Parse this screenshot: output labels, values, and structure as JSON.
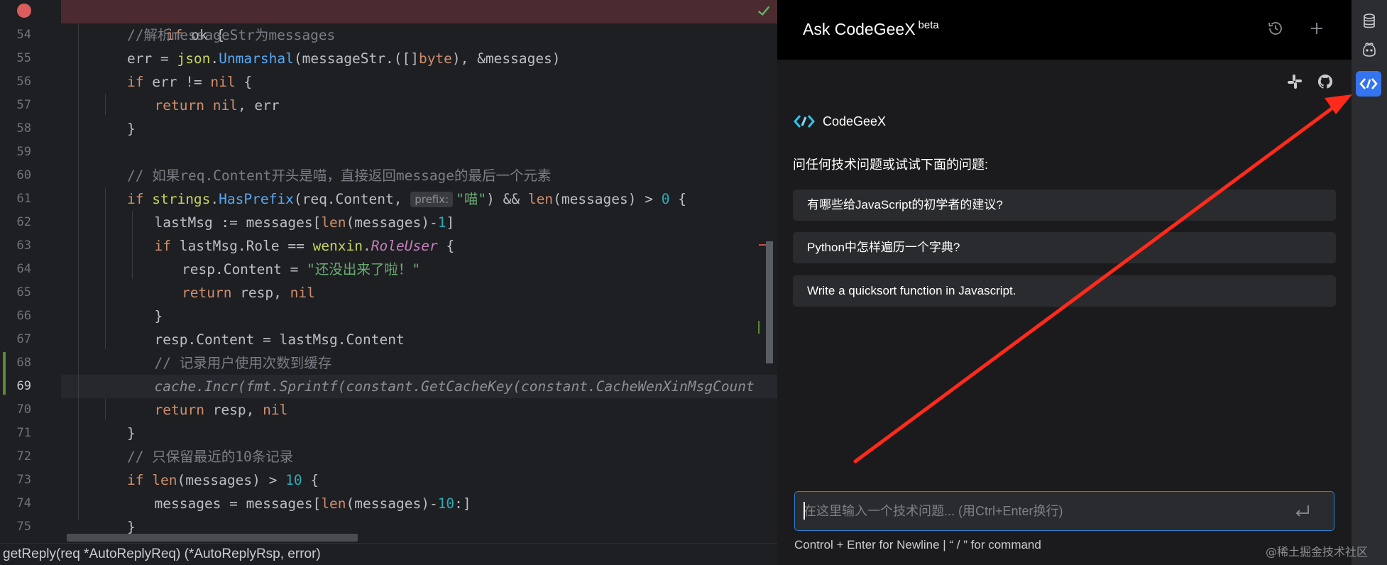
{
  "editor": {
    "breakpoint_line_text": "if ok {",
    "lines": [
      {
        "num": "54",
        "tokens": [
          [
            "cm",
            "//解析messageStr为messages"
          ]
        ]
      },
      {
        "num": "55",
        "tokens": [
          [
            "plain",
            "err = "
          ],
          [
            "pkg",
            "json"
          ],
          [
            "plain",
            "."
          ],
          [
            "fn",
            "Unmarshal"
          ],
          [
            "plain",
            "(messageStr.([]"
          ],
          [
            "kw",
            "byte"
          ],
          [
            "plain",
            "), &messages)"
          ]
        ]
      },
      {
        "num": "56",
        "tokens": [
          [
            "kw",
            "if"
          ],
          [
            "plain",
            " err != "
          ],
          [
            "kw",
            "nil"
          ],
          [
            "plain",
            " {"
          ]
        ]
      },
      {
        "num": "57",
        "tokens": [
          [
            "kw",
            "return"
          ],
          [
            "plain",
            " "
          ],
          [
            "kw",
            "nil"
          ],
          [
            "plain",
            ", err"
          ]
        ]
      },
      {
        "num": "58",
        "tokens": [
          [
            "plain",
            "}"
          ]
        ]
      },
      {
        "num": "59",
        "tokens": []
      },
      {
        "num": "60",
        "tokens": [
          [
            "cm",
            "// 如果req.Content开头是喵，直接返回message的最后一个元素"
          ]
        ]
      },
      {
        "num": "61",
        "tokens": [
          [
            "kw",
            "if"
          ],
          [
            "plain",
            " "
          ],
          [
            "pkg",
            "strings"
          ],
          [
            "plain",
            "."
          ],
          [
            "fn",
            "HasPrefix"
          ],
          [
            "plain",
            "(req.Content, "
          ],
          [
            "hint",
            "prefix:"
          ],
          [
            "str",
            "\"喵\""
          ],
          [
            "plain",
            ") && "
          ],
          [
            "kw",
            "len"
          ],
          [
            "plain",
            "(messages) > "
          ],
          [
            "num",
            "0"
          ],
          [
            "plain",
            " {"
          ]
        ]
      },
      {
        "num": "62",
        "tokens": [
          [
            "plain",
            "lastMsg := messages["
          ],
          [
            "kw",
            "len"
          ],
          [
            "plain",
            "(messages)-"
          ],
          [
            "num",
            "1"
          ],
          [
            "plain",
            "]"
          ]
        ]
      },
      {
        "num": "63",
        "tokens": [
          [
            "kw",
            "if"
          ],
          [
            "plain",
            " lastMsg.Role == "
          ],
          [
            "pkg",
            "wenxin"
          ],
          [
            "plain",
            "."
          ],
          [
            "const",
            "RoleUser"
          ],
          [
            "plain",
            " {"
          ]
        ]
      },
      {
        "num": "64",
        "tokens": [
          [
            "plain",
            "resp.Content = "
          ],
          [
            "str",
            "\"还没出来了啦！\""
          ]
        ]
      },
      {
        "num": "65",
        "tokens": [
          [
            "kw",
            "return"
          ],
          [
            "plain",
            " resp, "
          ],
          [
            "kw",
            "nil"
          ]
        ]
      },
      {
        "num": "66",
        "tokens": [
          [
            "plain",
            "}"
          ]
        ]
      },
      {
        "num": "67",
        "tokens": [
          [
            "plain",
            "resp.Content = lastMsg.Content"
          ]
        ]
      },
      {
        "num": "68",
        "tokens": [
          [
            "cm",
            "// 记录用户使用次数到缓存"
          ]
        ]
      },
      {
        "num": "69",
        "tokens": [
          [
            "ital",
            "cache.Incr(fmt.Sprintf(constant.GetCacheKey(constant.CacheWenXinMsgCount"
          ]
        ]
      },
      {
        "num": "70",
        "tokens": [
          [
            "kw",
            "return"
          ],
          [
            "plain",
            " resp, "
          ],
          [
            "kw",
            "nil"
          ]
        ]
      },
      {
        "num": "71",
        "tokens": [
          [
            "plain",
            "}"
          ]
        ]
      },
      {
        "num": "72",
        "tokens": [
          [
            "cm",
            "// 只保留最近的10条记录"
          ]
        ]
      },
      {
        "num": "73",
        "tokens": [
          [
            "kw",
            "if"
          ],
          [
            "plain",
            " "
          ],
          [
            "kw",
            "len"
          ],
          [
            "plain",
            "(messages) > "
          ],
          [
            "num",
            "10"
          ],
          [
            "plain",
            " {"
          ]
        ]
      },
      {
        "num": "74",
        "tokens": [
          [
            "plain",
            "messages = messages["
          ],
          [
            "kw",
            "len"
          ],
          [
            "plain",
            "(messages)-"
          ],
          [
            "num",
            "10"
          ],
          [
            "plain",
            ":]"
          ]
        ]
      },
      {
        "num": "75",
        "tokens": [
          [
            "plain",
            "}"
          ]
        ]
      }
    ],
    "status_text": "getReply(req *AutoReplyReq) (*AutoReplyRsp, error)"
  },
  "panel": {
    "title": "Ask CodeGeeX",
    "title_badge": "beta",
    "brand_name": "CodeGeeX",
    "prompt": "问任何技术问题或试试下面的问题:",
    "suggestions": [
      "有哪些给JavaScript的初学者的建议?",
      "Python中怎样遍历一个字典?",
      "Write a quicksort function in Javascript."
    ],
    "input_placeholder": "在这里输入一个技术问题... (用Ctrl+Enter换行)",
    "input_value": "",
    "hint_line": "Control + Enter for Newline | “ / ” for command",
    "icons": [
      "history-icon",
      "plus-icon",
      "slack-icon",
      "github-icon",
      "send-icon"
    ]
  },
  "toolstrip": {
    "icons": [
      "database-icon",
      "copilot-icon",
      "codegeex-icon"
    ],
    "active": "codegeex-icon",
    "accent": "#3574f0"
  },
  "annotation": {
    "arrow_color": "#ff2a1a"
  },
  "watermark": "@稀土掘金技术社区"
}
